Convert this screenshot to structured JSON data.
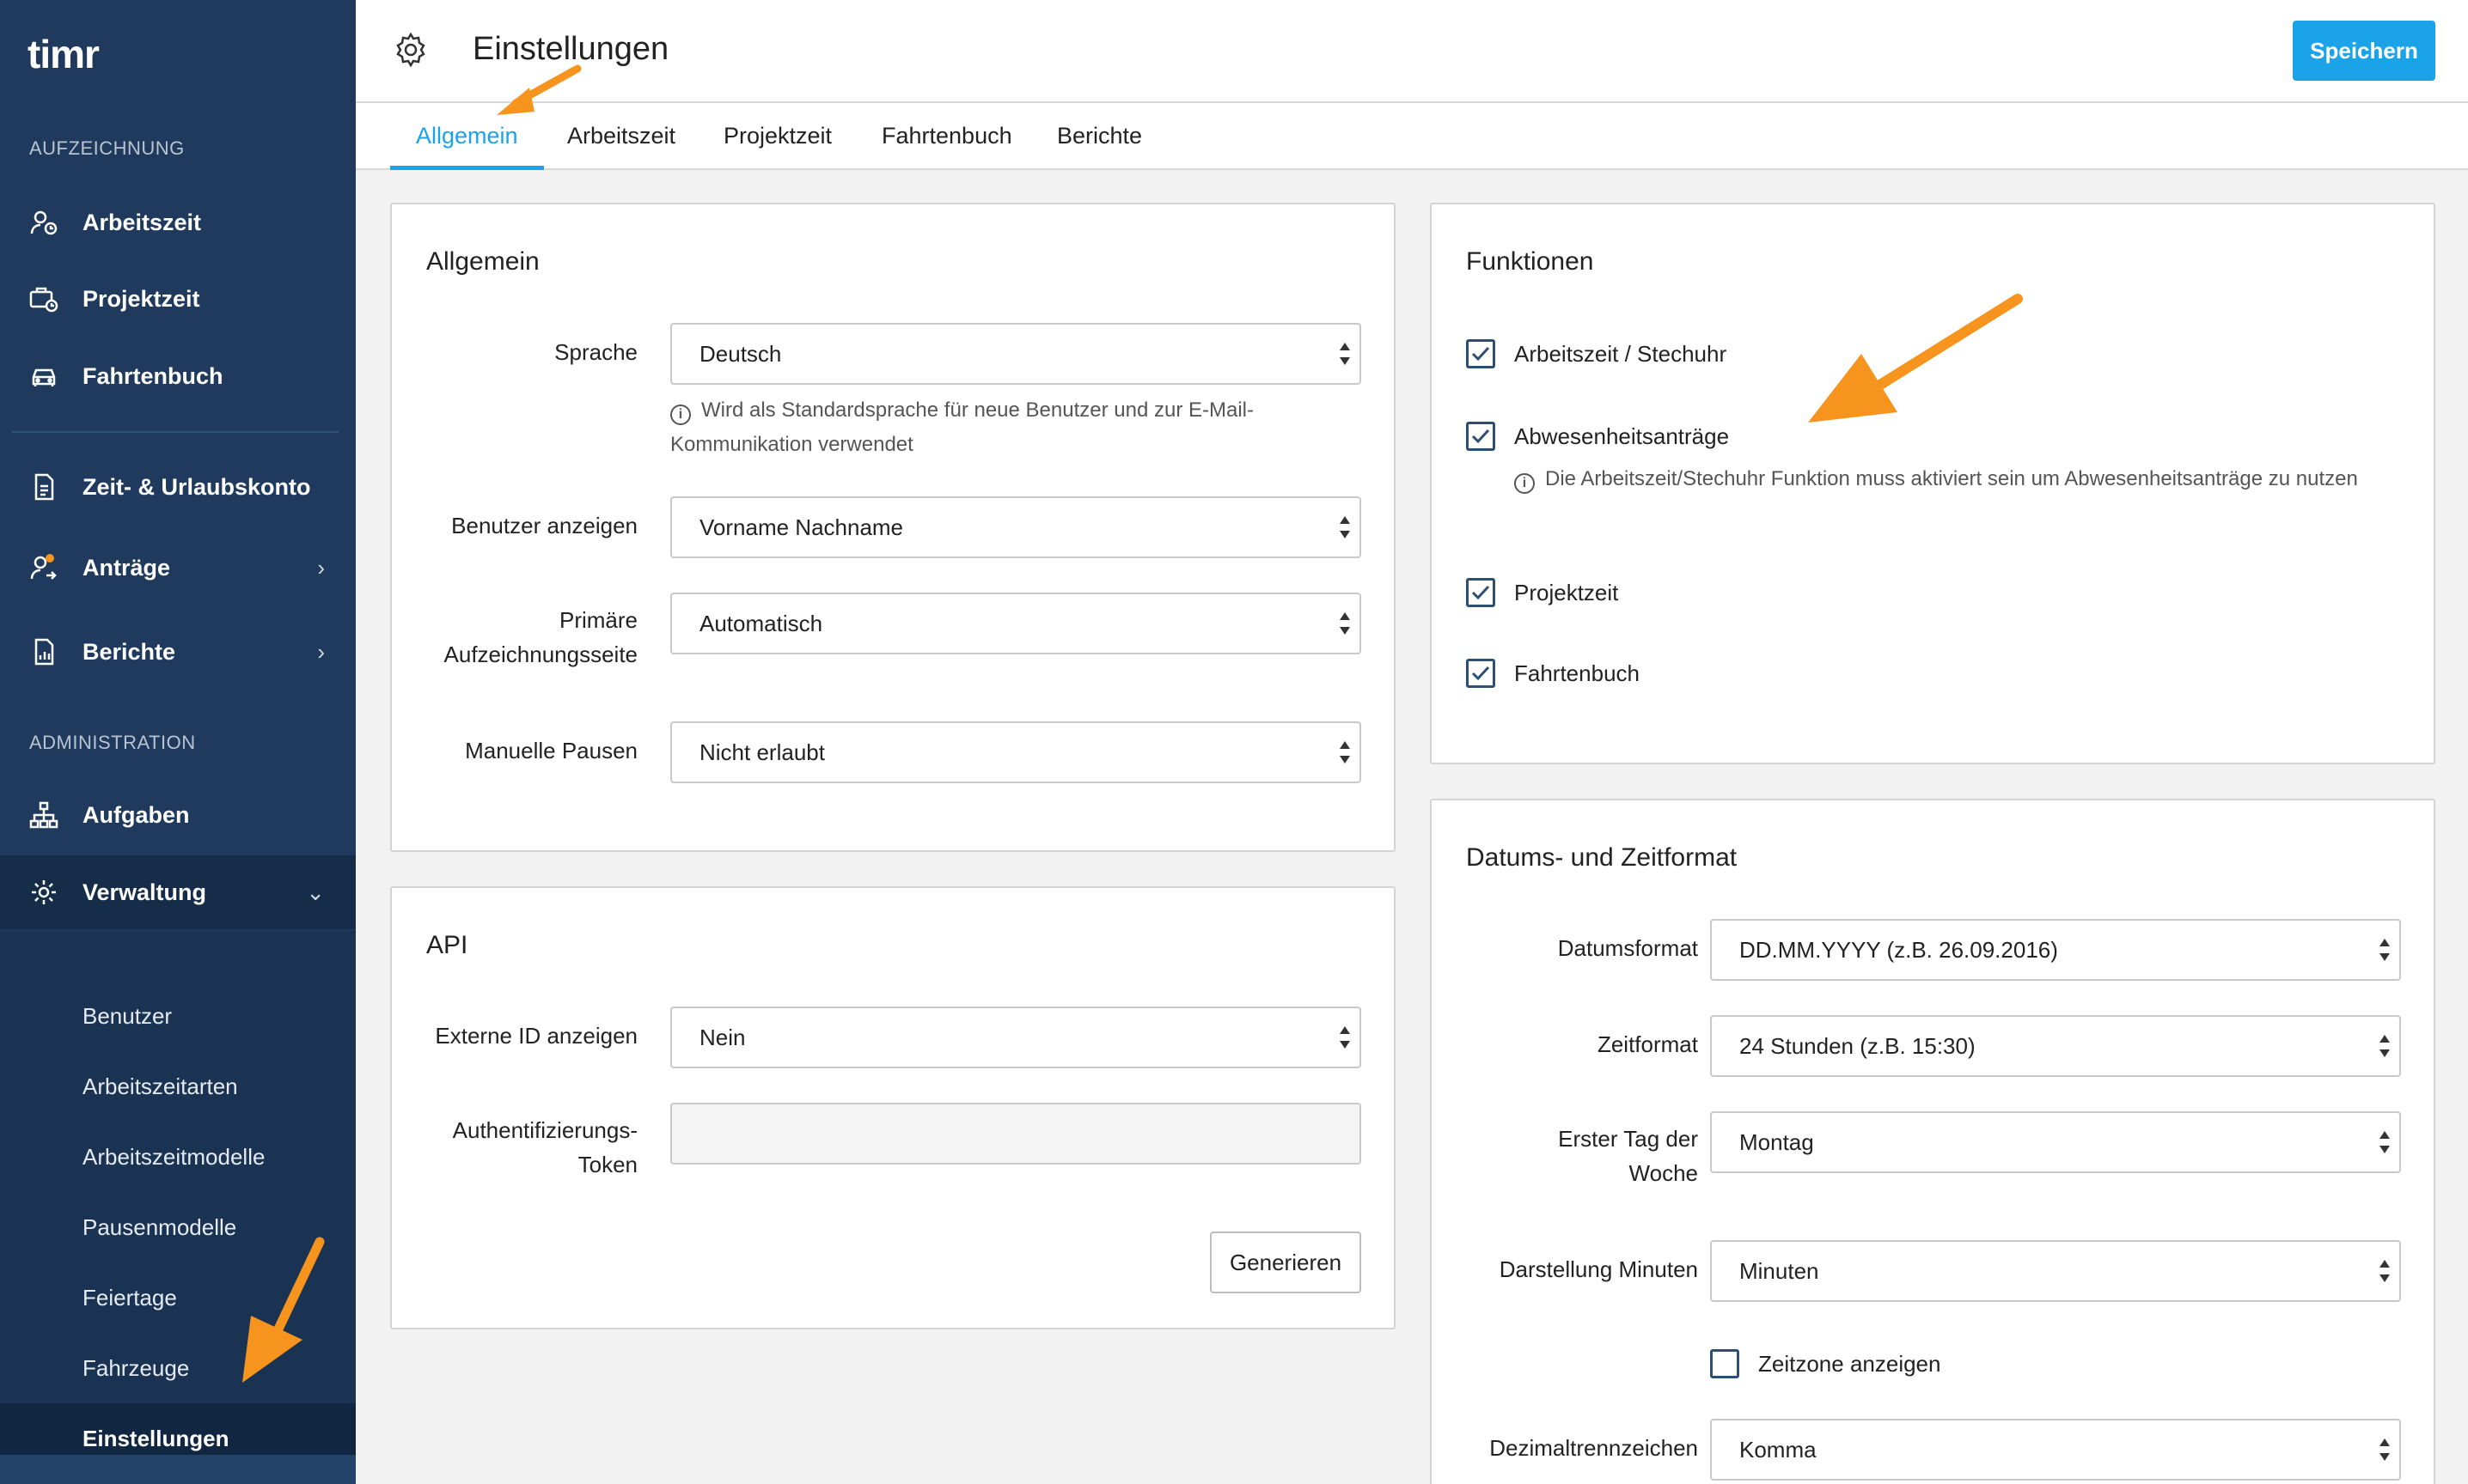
{
  "sidebar": {
    "logo": "timr",
    "section_recording": "AUFZEICHNUNG",
    "section_admin": "ADMINISTRATION",
    "items": {
      "arbeitszeit": "Arbeitszeit",
      "projektzeit": "Projektzeit",
      "fahrtenbuch": "Fahrtenbuch",
      "zeit_urlaub": "Zeit- & Urlaubskonto",
      "antraege": "Anträge",
      "berichte": "Berichte",
      "aufgaben": "Aufgaben",
      "verwaltung": "Verwaltung"
    },
    "sub_items": [
      "Benutzer",
      "Arbeitszeitarten",
      "Arbeitszeitmodelle",
      "Pausenmodelle",
      "Feiertage",
      "Fahrzeuge",
      "Einstellungen"
    ],
    "active_sub": "Einstellungen"
  },
  "header": {
    "title": "Einstellungen",
    "save_label": "Speichern"
  },
  "tabs": [
    "Allgemein",
    "Arbeitszeit",
    "Projektzeit",
    "Fahrtenbuch",
    "Berichte"
  ],
  "active_tab": "Allgemein",
  "general": {
    "title": "Allgemein",
    "language_label": "Sprache",
    "language_value": "Deutsch",
    "language_hint": "Wird als Standardsprache für neue Benutzer und zur E-Mail-Kommunikation verwendet",
    "show_user_label": "Benutzer anzeigen",
    "show_user_value": "Vorname Nachname",
    "primary_page_label": "Primäre Aufzeichnungsseite",
    "primary_page_value": "Automatisch",
    "manual_breaks_label": "Manuelle Pausen",
    "manual_breaks_value": "Nicht erlaubt"
  },
  "api": {
    "title": "API",
    "external_id_label": "Externe ID anzeigen",
    "external_id_value": "Nein",
    "token_label": "Authentifizierungs-Token",
    "token_value": "",
    "generate_label": "Generieren"
  },
  "features": {
    "title": "Funktionen",
    "items": [
      {
        "label": "Arbeitszeit / Stechuhr",
        "checked": true
      },
      {
        "label": "Abwesenheitsanträge",
        "checked": true
      },
      {
        "label": "Projektzeit",
        "checked": true
      },
      {
        "label": "Fahrtenbuch",
        "checked": true
      }
    ],
    "absence_hint": "Die Arbeitszeit/Stechuhr Funktion muss aktiviert sein um Abwesenheitsanträge zu nutzen"
  },
  "datetime": {
    "title": "Datums- und Zeitformat",
    "date_format_label": "Datumsformat",
    "date_format_value": "DD.MM.YYYY (z.B. 26.09.2016)",
    "time_format_label": "Zeitformat",
    "time_format_value": "24 Stunden (z.B. 15:30)",
    "first_day_label": "Erster Tag der Woche",
    "first_day_value": "Montag",
    "minutes_label": "Darstellung Minuten",
    "minutes_value": "Minuten",
    "timezone_label": "Zeitzone anzeigen",
    "timezone_checked": false,
    "decimal_label": "Dezimaltrennzeichen",
    "decimal_value": "Komma"
  },
  "colors": {
    "sidebar_bg": "#1f3a5c",
    "accent": "#1aa3e8",
    "annotation_arrow": "#f7941d",
    "notification_dot": "#f7941d"
  }
}
